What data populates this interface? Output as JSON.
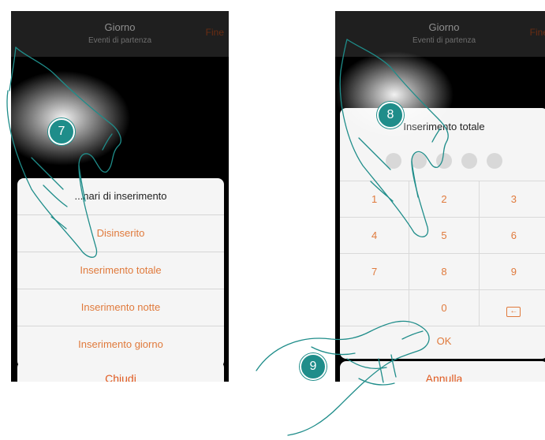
{
  "left_screen": {
    "topbar": {
      "title": "Giorno",
      "subtitle": "Eventi di partenza",
      "action": "Fine"
    },
    "sheet": {
      "title": "...nari di inserimento",
      "items": [
        {
          "label": "Disinserito"
        },
        {
          "label": "Inserimento totale"
        },
        {
          "label": "Inserimento notte"
        },
        {
          "label": "Inserimento giorno"
        }
      ]
    },
    "close_label": "Chiudi"
  },
  "right_screen": {
    "topbar": {
      "title": "Giorno",
      "subtitle": "Eventi di partenza",
      "action": "Fine"
    },
    "panel": {
      "title": "Inserimento totale",
      "keypad": [
        [
          "1",
          "2",
          "3"
        ],
        [
          "4",
          "5",
          "6"
        ],
        [
          "7",
          "8",
          "9"
        ],
        [
          "",
          "0",
          ""
        ]
      ],
      "ok_label": "OK"
    },
    "cancel_label": "Annulla"
  },
  "steps": {
    "seven": "7",
    "eight": "8",
    "nine": "9"
  },
  "colors": {
    "accent": "#e07a3c",
    "badge": "#1f8d8a",
    "hand_outline": "#1f8d8a",
    "sheet_bg": "#f5f5f5"
  }
}
